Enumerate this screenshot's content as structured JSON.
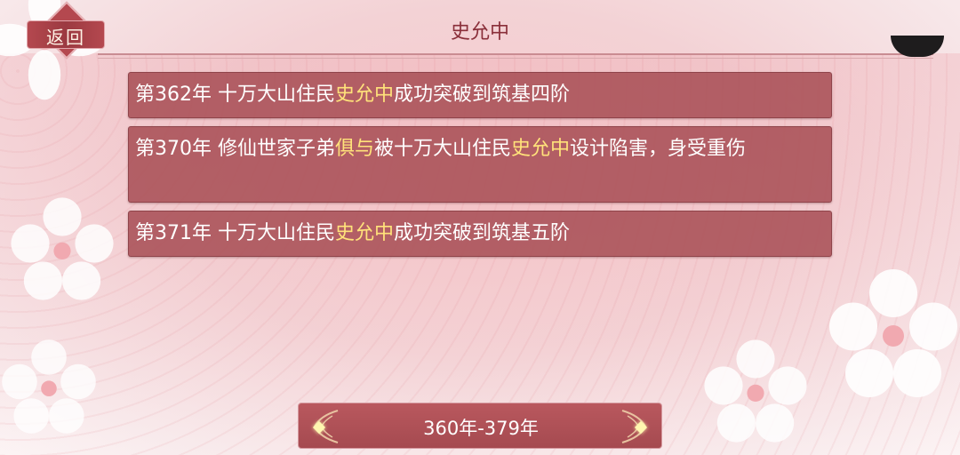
{
  "header": {
    "title": "史允中",
    "back_label": "返回"
  },
  "events": [
    {
      "parts": [
        {
          "text": "第362年 十万大山住民",
          "hl": false
        },
        {
          "text": "史允中",
          "hl": true
        },
        {
          "text": "成功突破到筑基四阶",
          "hl": false
        }
      ]
    },
    {
      "parts": [
        {
          "text": "第370年 修仙世家子弟",
          "hl": false
        },
        {
          "text": "俱与",
          "hl": true
        },
        {
          "text": "被十万大山住民",
          "hl": false
        },
        {
          "text": "史允中",
          "hl": true
        },
        {
          "text": "设计陷害，身受重伤",
          "hl": false
        }
      ]
    },
    {
      "parts": [
        {
          "text": "第371年 十万大山住民",
          "hl": false
        },
        {
          "text": "史允中",
          "hl": true
        },
        {
          "text": "成功突破到筑基五阶",
          "hl": false
        }
      ]
    }
  ],
  "range": {
    "label": "360年-379年"
  },
  "colors": {
    "highlight": "#ffe27a",
    "item_bg": "#a85056",
    "title": "#8a2f3a"
  }
}
